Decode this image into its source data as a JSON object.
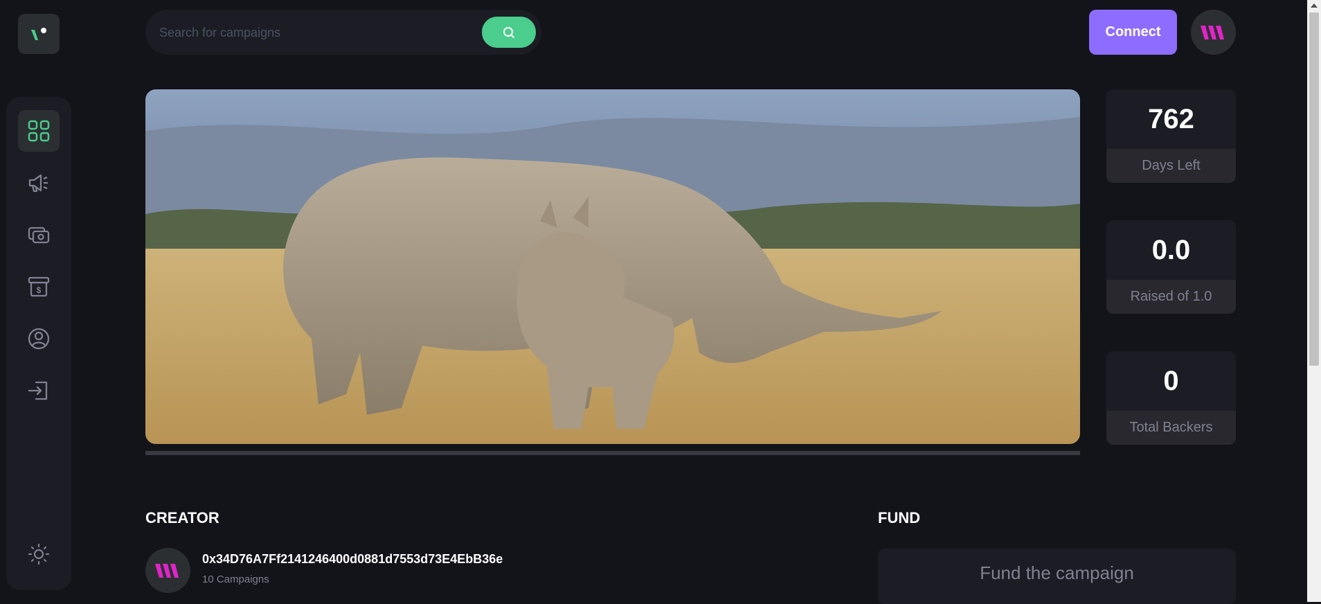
{
  "brand": {
    "logo_icon": "brand-logo-icon",
    "accent": "#4acd8d",
    "purple": "#8c6dfd"
  },
  "search": {
    "placeholder": "Search for campaigns",
    "icon": "search-icon"
  },
  "header": {
    "connect_label": "Connect",
    "avatar_icon": "thirdweb-logo-icon"
  },
  "sidebar": {
    "items": [
      {
        "name": "dashboard",
        "icon": "dashboard-grid-icon",
        "active": true
      },
      {
        "name": "campaign",
        "icon": "megaphone-icon",
        "active": false
      },
      {
        "name": "payment",
        "icon": "payment-icon",
        "active": false
      },
      {
        "name": "withdraw",
        "icon": "withdraw-icon",
        "active": false
      },
      {
        "name": "profile",
        "icon": "profile-icon",
        "active": false
      },
      {
        "name": "logout",
        "icon": "logout-icon",
        "active": false
      }
    ],
    "theme_icon": "sun-icon"
  },
  "campaign": {
    "progress_percent": 0,
    "stats": [
      {
        "value": "762",
        "label": "Days Left"
      },
      {
        "value": "0.0",
        "label": "Raised of 1.0"
      },
      {
        "value": "0",
        "label": "Total Backers"
      }
    ]
  },
  "creator": {
    "title": "Creator",
    "address": "0x34D76A7Ff2141246400d0881d7553d73E4EbB36e",
    "campaigns": "10 Campaigns"
  },
  "fund": {
    "title": "Fund",
    "box_title": "Fund the campaign"
  }
}
